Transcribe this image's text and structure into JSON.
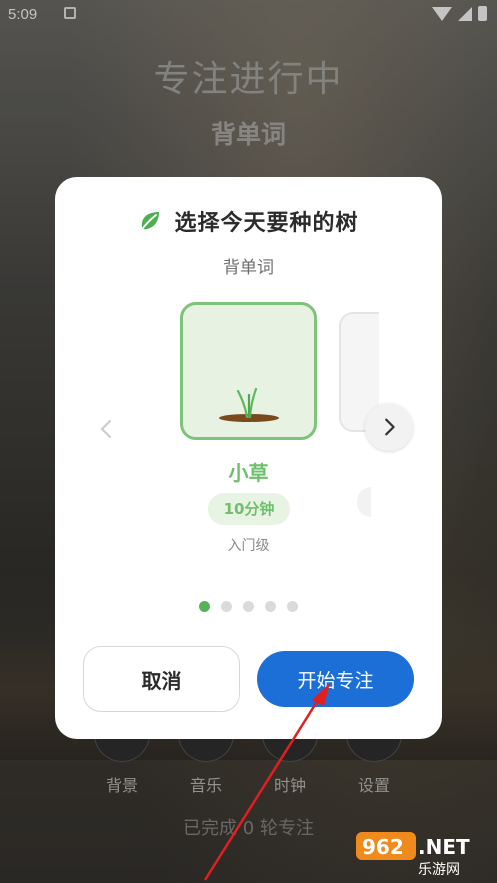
{
  "status_bar": {
    "time": "5:09"
  },
  "background": {
    "title": "专注进行中",
    "task": "背单词",
    "nav": [
      {
        "label": "背景",
        "icon": "background-icon"
      },
      {
        "label": "音乐",
        "icon": "music-icon"
      },
      {
        "label": "时钟",
        "icon": "clock-icon"
      },
      {
        "label": "设置",
        "icon": "settings-icon"
      }
    ],
    "completed_text": "已完成 0 轮专注"
  },
  "dialog": {
    "title": "选择今天要种的树",
    "subtitle": "背单词",
    "selected_tree": {
      "name": "小草",
      "duration": "10分钟",
      "level": "入门级"
    },
    "page_count": 5,
    "active_page": 0,
    "cancel_label": "取消",
    "start_label": "开始专注",
    "colors": {
      "accent_green": "#6fbf6c",
      "primary_blue": "#1b6fd6"
    }
  },
  "watermark": {
    "brand": "962.NET",
    "sub": "乐游网"
  }
}
